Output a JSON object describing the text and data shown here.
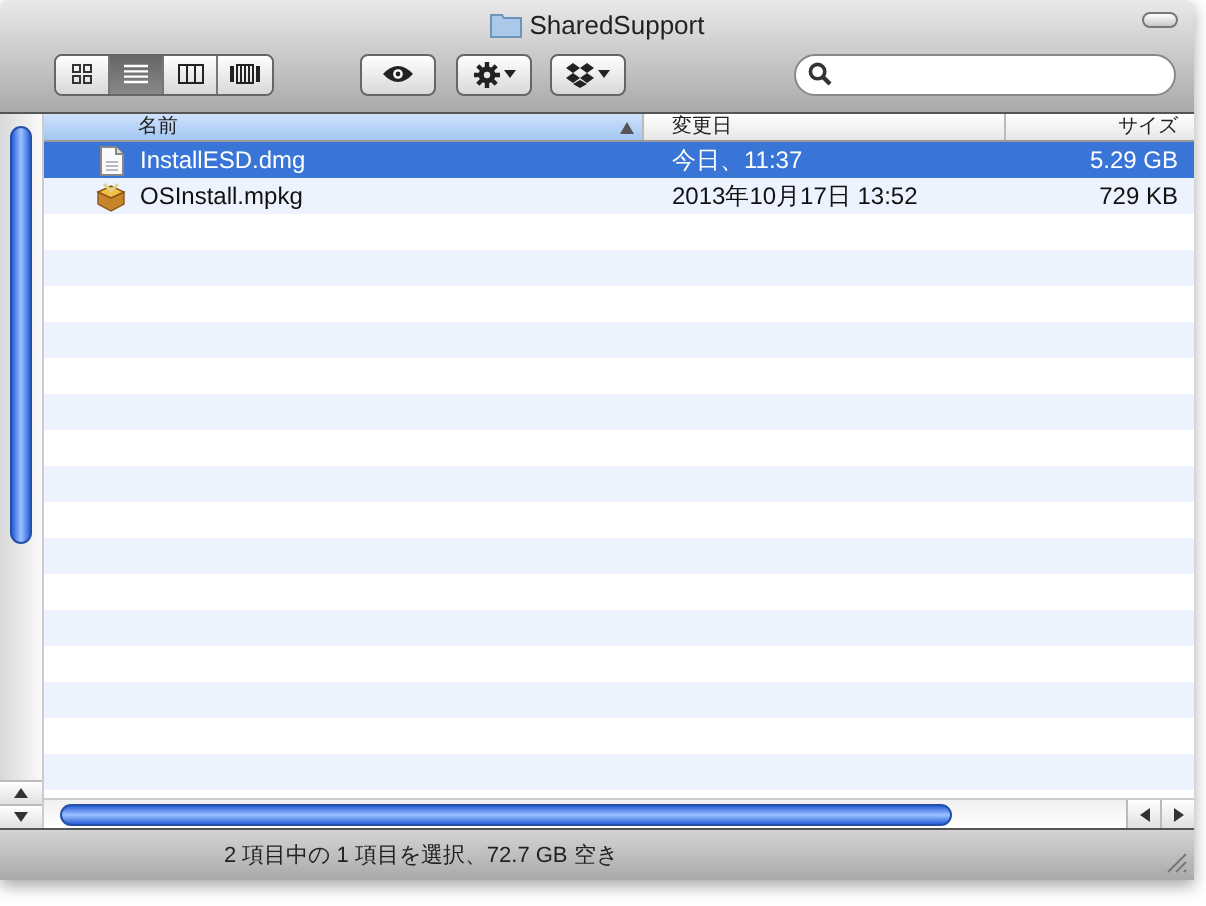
{
  "window": {
    "title": "SharedSupport"
  },
  "view_buttons": [
    {
      "kind": "icons",
      "selected": false
    },
    {
      "kind": "list",
      "selected": true
    },
    {
      "kind": "columns",
      "selected": false
    },
    {
      "kind": "coverflow",
      "selected": false
    }
  ],
  "columns": [
    {
      "label": "名前",
      "sorted": true
    },
    {
      "label": "変更日",
      "sorted": false
    },
    {
      "label": "サイズ",
      "sorted": false
    }
  ],
  "rows": [
    {
      "kind": "document",
      "name": "InstallESD.dmg",
      "modified": "今日、11:37",
      "size": "5.29 GB",
      "selected": true
    },
    {
      "kind": "package",
      "name": "OSInstall.mpkg",
      "modified": "2013年10月17日 13:52",
      "size": "729 KB",
      "selected": false
    }
  ],
  "status_bar": "2 項目中の 1 項目を選択、72.7 GB 空き"
}
